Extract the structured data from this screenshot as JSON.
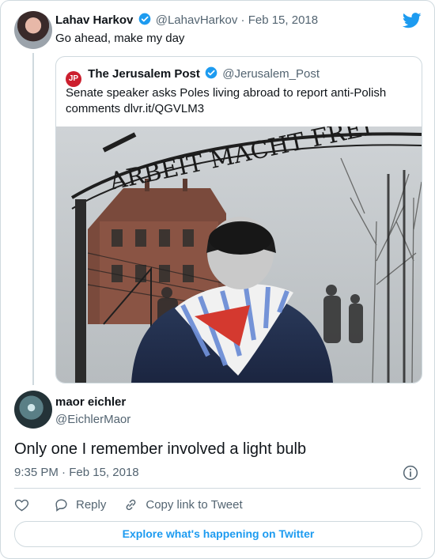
{
  "parent": {
    "name": "Lahav Harkov",
    "handle": "@LahavHarkov",
    "date": "Feb 15, 2018",
    "separator": "·",
    "text": "Go ahead, make my day"
  },
  "quoted": {
    "logo_text": "JP",
    "name": "The Jerusalem Post",
    "handle": "@Jerusalem_Post",
    "text": "Senate speaker asks Poles living abroad to report anti-Polish comments dlvr.it/QGVLM3",
    "image_sign_text": "ARBEIT MACHT FREI"
  },
  "reply": {
    "name": "maor eichler",
    "handle": "@EichlerMaor",
    "text": "Only one I remember involved a light bulb",
    "time": "9:35 PM",
    "separator": "·",
    "date": "Feb 15, 2018"
  },
  "actions": {
    "reply_label": "Reply",
    "copy_label": "Copy link to Tweet"
  },
  "explore_label": "Explore what's happening on Twitter",
  "colors": {
    "accent": "#1d9bf0",
    "border": "#cfd9de",
    "muted": "#536471",
    "jpost_red": "#cc1f2e"
  },
  "icons": [
    "verified-badge-icon",
    "twitter-bird-icon",
    "info-icon",
    "heart-icon",
    "reply-icon",
    "link-icon"
  ]
}
